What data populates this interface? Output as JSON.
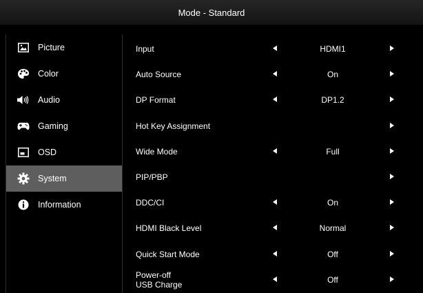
{
  "header": {
    "title": "Mode - Standard"
  },
  "sidebar": {
    "items": [
      {
        "label": "Picture",
        "icon": "picture-icon",
        "selected": false
      },
      {
        "label": "Color",
        "icon": "palette-icon",
        "selected": false
      },
      {
        "label": "Audio",
        "icon": "speaker-icon",
        "selected": false
      },
      {
        "label": "Gaming",
        "icon": "gamepad-icon",
        "selected": false
      },
      {
        "label": "OSD",
        "icon": "osd-icon",
        "selected": false
      },
      {
        "label": "System",
        "icon": "gear-icon",
        "selected": true
      },
      {
        "label": "Information",
        "icon": "info-icon",
        "selected": false
      }
    ]
  },
  "settings": {
    "rows": [
      {
        "label": "Input",
        "value": "HDMI1",
        "left_arrow": true,
        "right_arrow": true
      },
      {
        "label": "Auto Source",
        "value": "On",
        "left_arrow": true,
        "right_arrow": true
      },
      {
        "label": "DP Format",
        "value": "DP1.2",
        "left_arrow": true,
        "right_arrow": true
      },
      {
        "label": "Hot Key Assignment",
        "value": "",
        "left_arrow": false,
        "right_arrow": true
      },
      {
        "label": "Wide Mode",
        "value": "Full",
        "left_arrow": true,
        "right_arrow": true
      },
      {
        "label": "PIP/PBP",
        "value": "",
        "left_arrow": false,
        "right_arrow": true
      },
      {
        "label": "DDC/CI",
        "value": "On",
        "left_arrow": true,
        "right_arrow": true
      },
      {
        "label": "HDMI Black Level",
        "value": "Normal",
        "left_arrow": true,
        "right_arrow": true
      },
      {
        "label": "Quick Start Mode",
        "value": "Off",
        "left_arrow": true,
        "right_arrow": true
      },
      {
        "label": "Power-off\nUSB Charge",
        "value": "Off",
        "left_arrow": true,
        "right_arrow": true
      }
    ]
  },
  "colors": {
    "background": "#000000",
    "header_band": "#1c1c1c",
    "selected_item": "#5e5e5e",
    "text": "#ffffff"
  }
}
